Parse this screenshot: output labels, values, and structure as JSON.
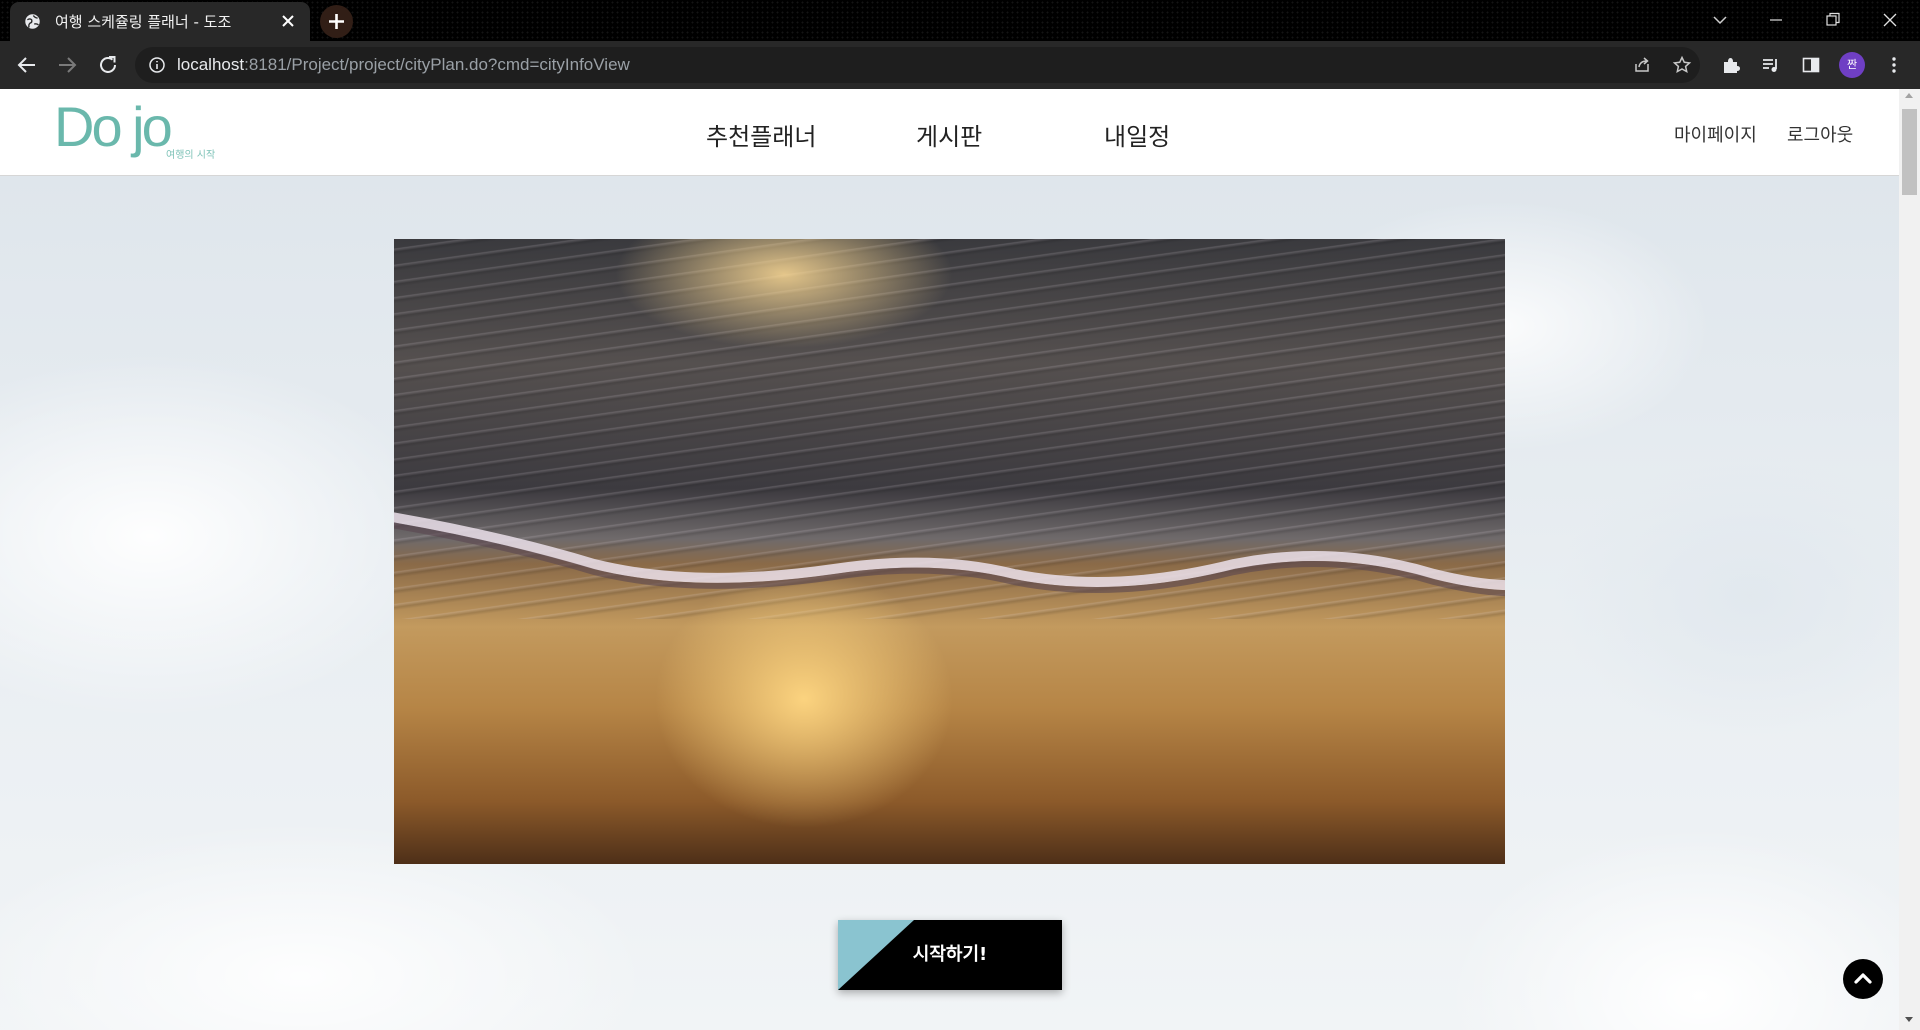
{
  "browser": {
    "tab_title": "여행 스케쥴링 플래너 - 도조",
    "url_host": "localhost",
    "url_rest": ":8181/Project/project/cityPlan.do?cmd=cityInfoView",
    "profile_initial": "짠"
  },
  "site": {
    "logo_text": "Do jo",
    "logo_subtitle": "여행의 시작",
    "nav": {
      "recommend": "추천플래너",
      "board": "게시판",
      "my_schedule": "내일정"
    },
    "util": {
      "mypage": "마이페이지",
      "logout": "로그아웃"
    }
  },
  "main": {
    "start_button": "시작하기!"
  },
  "colors": {
    "logo": "#6ab8ac",
    "button_bg": "#000000",
    "button_accent": "#8ac4d0"
  }
}
